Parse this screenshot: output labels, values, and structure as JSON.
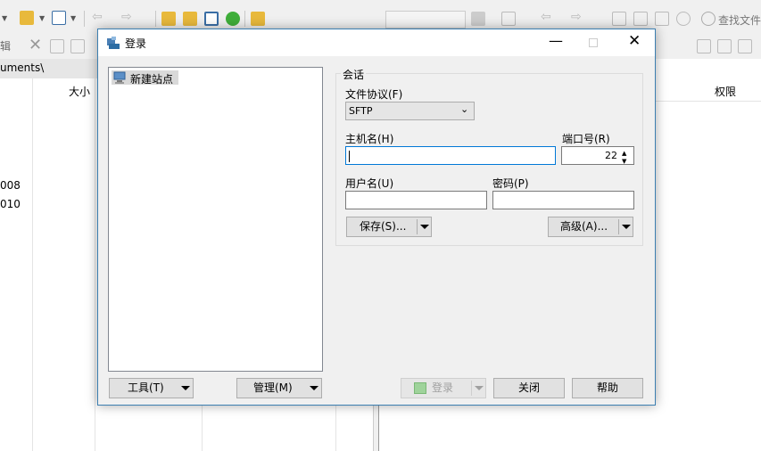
{
  "background": {
    "left_pane": {
      "path": "uments\\",
      "col_size": "大小",
      "rows": [
        "008",
        "010"
      ]
    },
    "right_pane": {
      "search_label": "查找文件",
      "col_permissions": "权限"
    },
    "toolbar_fragment": "辑"
  },
  "dialog": {
    "title": "登录",
    "site_tree": {
      "new_site_label": "新建站点"
    },
    "session": {
      "group_label": "会话",
      "protocol_label": "文件协议(F)",
      "protocol_value": "SFTP",
      "host_label": "主机名(H)",
      "host_value": "",
      "port_label": "端口号(R)",
      "port_value": "22",
      "user_label": "用户名(U)",
      "user_value": "",
      "password_label": "密码(P)",
      "password_value": "",
      "save_button": "保存(S)...",
      "advanced_button": "高级(A)..."
    },
    "buttons": {
      "tools": "工具(T)",
      "manage": "管理(M)",
      "login": "登录",
      "close": "关闭",
      "help": "帮助"
    },
    "colors": {
      "accent": "#0078d7",
      "border_blue": "#3c7fb1"
    }
  }
}
